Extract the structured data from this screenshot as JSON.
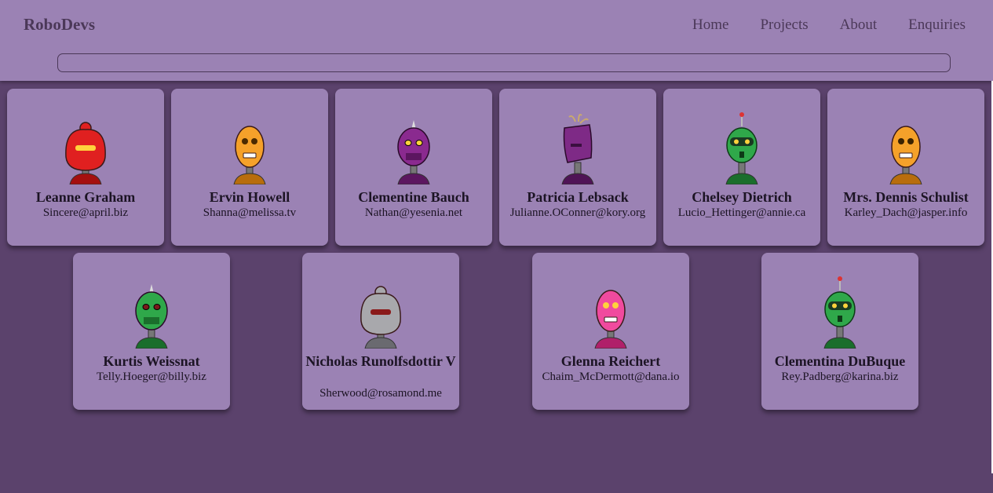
{
  "header": {
    "logo": "RoboDevs",
    "nav": [
      "Home",
      "Projects",
      "About",
      "Enquiries"
    ],
    "search_value": ""
  },
  "robots": [
    {
      "name": "Leanne Graham",
      "email": "Sincere@april.biz",
      "color": "#e02020",
      "accent": "#a50f0f",
      "eyes": "#ffd23c",
      "style": "round"
    },
    {
      "name": "Ervin Howell",
      "email": "Shanna@melissa.tv",
      "color": "#f5a12a",
      "accent": "#b86d0c",
      "eyes": "#4a2a00",
      "style": "oval"
    },
    {
      "name": "Clementine Bauch",
      "email": "Nathan@yesenia.net",
      "color": "#8a2a8f",
      "accent": "#5c1660",
      "eyes": "#ffd23c",
      "style": "broad"
    },
    {
      "name": "Patricia Lebsack",
      "email": "Julianne.OConner@kory.org",
      "color": "#7e2a86",
      "accent": "#4f1456",
      "eyes": "#3b0f40",
      "style": "box"
    },
    {
      "name": "Chelsey Dietrich",
      "email": "Lucio_Hettinger@annie.ca",
      "color": "#2fa84a",
      "accent": "#1a6e2c",
      "eyes": "#ffd23c",
      "style": "antenna"
    },
    {
      "name": "Mrs. Dennis Schulist",
      "email": "Karley_Dach@jasper.info",
      "color": "#f5a12a",
      "accent": "#b86d0c",
      "eyes": "#3b2200",
      "style": "oval"
    },
    {
      "name": "Kurtis Weissnat",
      "email": "Telly.Hoeger@billy.biz",
      "color": "#2fa84a",
      "accent": "#1a6e2c",
      "eyes": "#7a1a1a",
      "style": "broad"
    },
    {
      "name": "Nicholas Runolfsdottir V",
      "email": "Sherwood@rosamond.me",
      "color": "#a8a8ac",
      "accent": "#6a6a70",
      "eyes": "#8a1a1a",
      "style": "round"
    },
    {
      "name": "Glenna Reichert",
      "email": "Chaim_McDermott@dana.io",
      "color": "#f04a9e",
      "accent": "#b0206a",
      "eyes": "#ffd23c",
      "style": "oval"
    },
    {
      "name": "Clementina DuBuque",
      "email": "Rey.Padberg@karina.biz",
      "color": "#2fa84a",
      "accent": "#1a6e2c",
      "eyes": "#ffd23c",
      "style": "antenna"
    }
  ]
}
